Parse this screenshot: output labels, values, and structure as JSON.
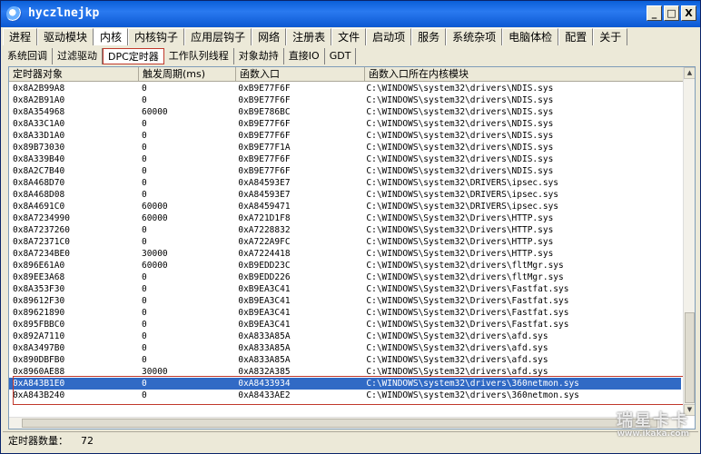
{
  "window": {
    "title": "hyczlnejkp",
    "min_label": "_",
    "max_label": "□",
    "close_label": "X"
  },
  "main_tabs": [
    {
      "label": "进程"
    },
    {
      "label": "驱动模块"
    },
    {
      "label": "内核",
      "active": true
    },
    {
      "label": "内核钩子"
    },
    {
      "label": "应用层钩子"
    },
    {
      "label": "网络"
    },
    {
      "label": "注册表"
    },
    {
      "label": "文件"
    },
    {
      "label": "启动项"
    },
    {
      "label": "服务"
    },
    {
      "label": "系统杂项"
    },
    {
      "label": "电脑体检"
    },
    {
      "label": "配置"
    },
    {
      "label": "关于"
    }
  ],
  "sub_tabs": [
    {
      "label": "系统回调"
    },
    {
      "label": "过滤驱动"
    },
    {
      "label": "DPC定时器",
      "active": true
    },
    {
      "label": "工作队列线程"
    },
    {
      "label": "对象劫持"
    },
    {
      "label": "直接IO"
    },
    {
      "label": "GDT"
    }
  ],
  "table": {
    "columns": [
      "定时器对象",
      "触发周期(ms)",
      "函数入口",
      "函数入口所在内核模块"
    ],
    "rows": [
      [
        "0x8A2B99A8",
        "0",
        "0xB9E77F6F",
        "C:\\WINDOWS\\system32\\drivers\\NDIS.sys"
      ],
      [
        "0x8A2B91A0",
        "0",
        "0xB9E77F6F",
        "C:\\WINDOWS\\system32\\drivers\\NDIS.sys"
      ],
      [
        "0x8A354968",
        "60000",
        "0xB9E786BC",
        "C:\\WINDOWS\\system32\\drivers\\NDIS.sys"
      ],
      [
        "0x8A33C1A0",
        "0",
        "0xB9E77F6F",
        "C:\\WINDOWS\\system32\\drivers\\NDIS.sys"
      ],
      [
        "0x8A33D1A0",
        "0",
        "0xB9E77F6F",
        "C:\\WINDOWS\\system32\\drivers\\NDIS.sys"
      ],
      [
        "0x89B73030",
        "0",
        "0xB9E77F1A",
        "C:\\WINDOWS\\system32\\drivers\\NDIS.sys"
      ],
      [
        "0x8A339B40",
        "0",
        "0xB9E77F6F",
        "C:\\WINDOWS\\system32\\drivers\\NDIS.sys"
      ],
      [
        "0x8A2C7B40",
        "0",
        "0xB9E77F6F",
        "C:\\WINDOWS\\system32\\drivers\\NDIS.sys"
      ],
      [
        "0x8A468D70",
        "0",
        "0xA84593E7",
        "C:\\WINDOWS\\system32\\DRIVERS\\ipsec.sys"
      ],
      [
        "0x8A468D08",
        "0",
        "0xA84593E7",
        "C:\\WINDOWS\\system32\\DRIVERS\\ipsec.sys"
      ],
      [
        "0x8A4691C0",
        "60000",
        "0xA8459471",
        "C:\\WINDOWS\\system32\\DRIVERS\\ipsec.sys"
      ],
      [
        "0x8A7234990",
        "60000",
        "0xA721D1F8",
        "C:\\WINDOWS\\System32\\Drivers\\HTTP.sys"
      ],
      [
        "0x8A7237260",
        "0",
        "0xA7228832",
        "C:\\WINDOWS\\System32\\Drivers\\HTTP.sys"
      ],
      [
        "0x8A72371C0",
        "0",
        "0xA722A9FC",
        "C:\\WINDOWS\\System32\\Drivers\\HTTP.sys"
      ],
      [
        "0x8A7234BE0",
        "30000",
        "0xA7224418",
        "C:\\WINDOWS\\System32\\Drivers\\HTTP.sys"
      ],
      [
        "0x896E61A0",
        "60000",
        "0xB9EDD23C",
        "C:\\WINDOWS\\system32\\drivers\\fltMgr.sys"
      ],
      [
        "0x89EE3A68",
        "0",
        "0xB9EDD226",
        "C:\\WINDOWS\\system32\\drivers\\fltMgr.sys"
      ],
      [
        "0x8A353F30",
        "0",
        "0xB9EA3C41",
        "C:\\WINDOWS\\System32\\Drivers\\Fastfat.sys"
      ],
      [
        "0x89612F30",
        "0",
        "0xB9EA3C41",
        "C:\\WINDOWS\\System32\\Drivers\\Fastfat.sys"
      ],
      [
        "0x89621890",
        "0",
        "0xB9EA3C41",
        "C:\\WINDOWS\\System32\\Drivers\\Fastfat.sys"
      ],
      [
        "0x895FBBC0",
        "0",
        "0xB9EA3C41",
        "C:\\WINDOWS\\System32\\Drivers\\Fastfat.sys"
      ],
      [
        "0x892A7110",
        "0",
        "0xA833A85A",
        "C:\\WINDOWS\\System32\\drivers\\afd.sys"
      ],
      [
        "0x8A3497B0",
        "0",
        "0xA833A85A",
        "C:\\WINDOWS\\System32\\drivers\\afd.sys"
      ],
      [
        "0x890DBFB0",
        "0",
        "0xA833A85A",
        "C:\\WINDOWS\\System32\\drivers\\afd.sys"
      ],
      [
        "0x8960AE88",
        "30000",
        "0xA832A385",
        "C:\\WINDOWS\\System32\\drivers\\afd.sys"
      ],
      [
        "0xA843B1E0",
        "0",
        "0xA8433934",
        "C:\\WINDOWS\\system32\\drivers\\360netmon.sys"
      ],
      [
        "0xA843B240",
        "0",
        "0xA8433AE2",
        "C:\\WINDOWS\\system32\\drivers\\360netmon.sys"
      ]
    ],
    "selected_row": 25
  },
  "status": {
    "label": "定时器数量：",
    "count": "72"
  },
  "watermark": {
    "brand": "瑞星卡卡",
    "url": "www.ikaka.com"
  }
}
